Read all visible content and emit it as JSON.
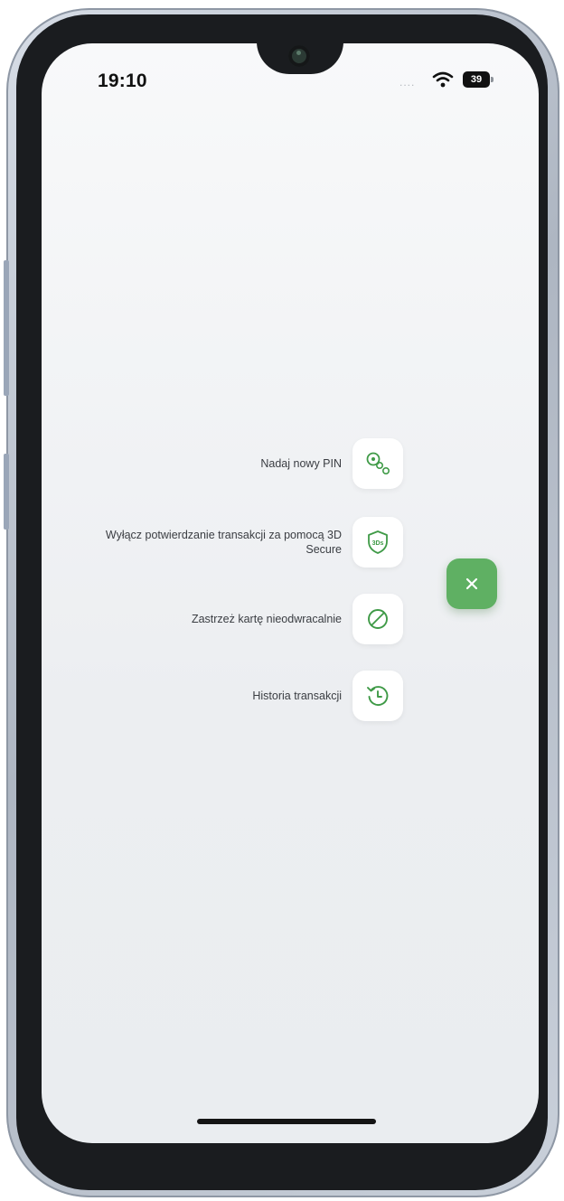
{
  "status_bar": {
    "time": "19:10",
    "signal_dots": "....",
    "battery_level": "39",
    "wifi_icon": "wifi-icon",
    "battery_icon": "battery-icon"
  },
  "menu": {
    "items": [
      {
        "label": "Nadaj nowy PIN",
        "icon": "key-pin-icon"
      },
      {
        "label": "Wyłącz potwierdzanie transakcji za pomocą 3D Secure",
        "icon": "shield-3ds-icon"
      },
      {
        "label": "Zastrzeż kartę nieodwracalnie",
        "icon": "block-icon"
      },
      {
        "label": "Historia transakcji",
        "icon": "history-clock-icon"
      }
    ]
  },
  "close_button": {
    "symbol": "×",
    "icon": "close-icon"
  },
  "colors": {
    "accent_green": "#5fb063",
    "icon_green": "#3f9a47",
    "screen_bg": "#eceef1",
    "label_text": "#3a3d42"
  }
}
